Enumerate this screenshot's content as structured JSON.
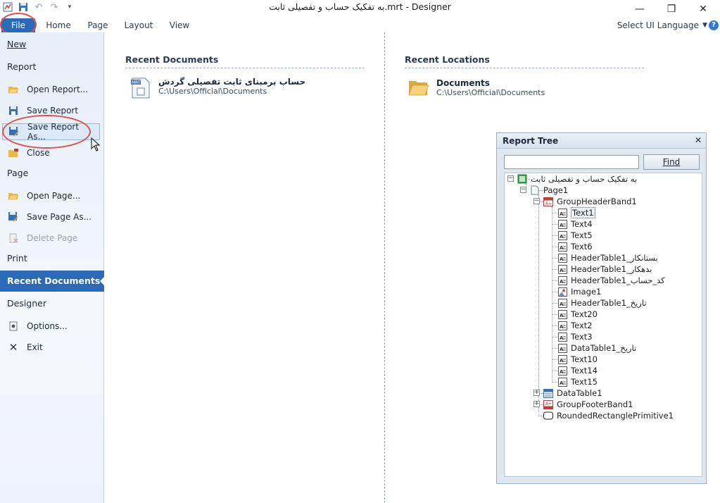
{
  "window": {
    "title": "به تفکیک حساب و تفصیلی ثابت.mrt - Designer",
    "minimize_glyph": "—",
    "restore_glyph": "❐",
    "close_glyph": "✕"
  },
  "ribbon": {
    "tabs": [
      "File",
      "Home",
      "Page",
      "Layout",
      "View"
    ],
    "language_label": "Select UI Language",
    "help_glyph": "?"
  },
  "backstage": {
    "new_label": "New",
    "report_header": "Report",
    "open_report": "Open Report...",
    "save_report": "Save Report",
    "save_report_as": "Save Report As...",
    "close": "Close",
    "page_header": "Page",
    "open_page": "Open Page...",
    "save_page_as": "Save Page As...",
    "delete_page": "Delete Page",
    "print_header": "Print",
    "recent_documents": "Recent Documents",
    "designer_header": "Designer",
    "options": "Options...",
    "exit": "Exit"
  },
  "recent_documents": {
    "title": "Recent Documents",
    "items": [
      {
        "name": "حساب برمبنای ثابت تفصیلی گردش",
        "path": "C:\\Users\\Official\\Documents"
      }
    ]
  },
  "recent_locations": {
    "title": "Recent Locations",
    "items": [
      {
        "name": "Documents",
        "path": "C:\\Users\\Official\\Documents"
      }
    ]
  },
  "report_tree": {
    "title": "Report Tree",
    "search_value": "",
    "find_label": "Find",
    "nodes": {
      "root": "به تفکیک حساب و تفصیلی ثابت",
      "page1": "Page1",
      "group_header": "GroupHeaderBand1",
      "children": [
        "Text1",
        "Text4",
        "Text5",
        "Text6",
        "HeaderTable1_بستانکار",
        "HeaderTable1_بدهکار",
        "HeaderTable1_کد_حساب",
        "Image1",
        "HeaderTable1_تاریخ",
        "Text20",
        "Text2",
        "Text3",
        "DataTable1_تاریخ",
        "Text10",
        "Text14",
        "Text15"
      ],
      "data_table": "DataTable1",
      "group_footer": "GroupFooterBand1",
      "rounded_rect": "RoundedRectanglePrimitive1"
    }
  }
}
